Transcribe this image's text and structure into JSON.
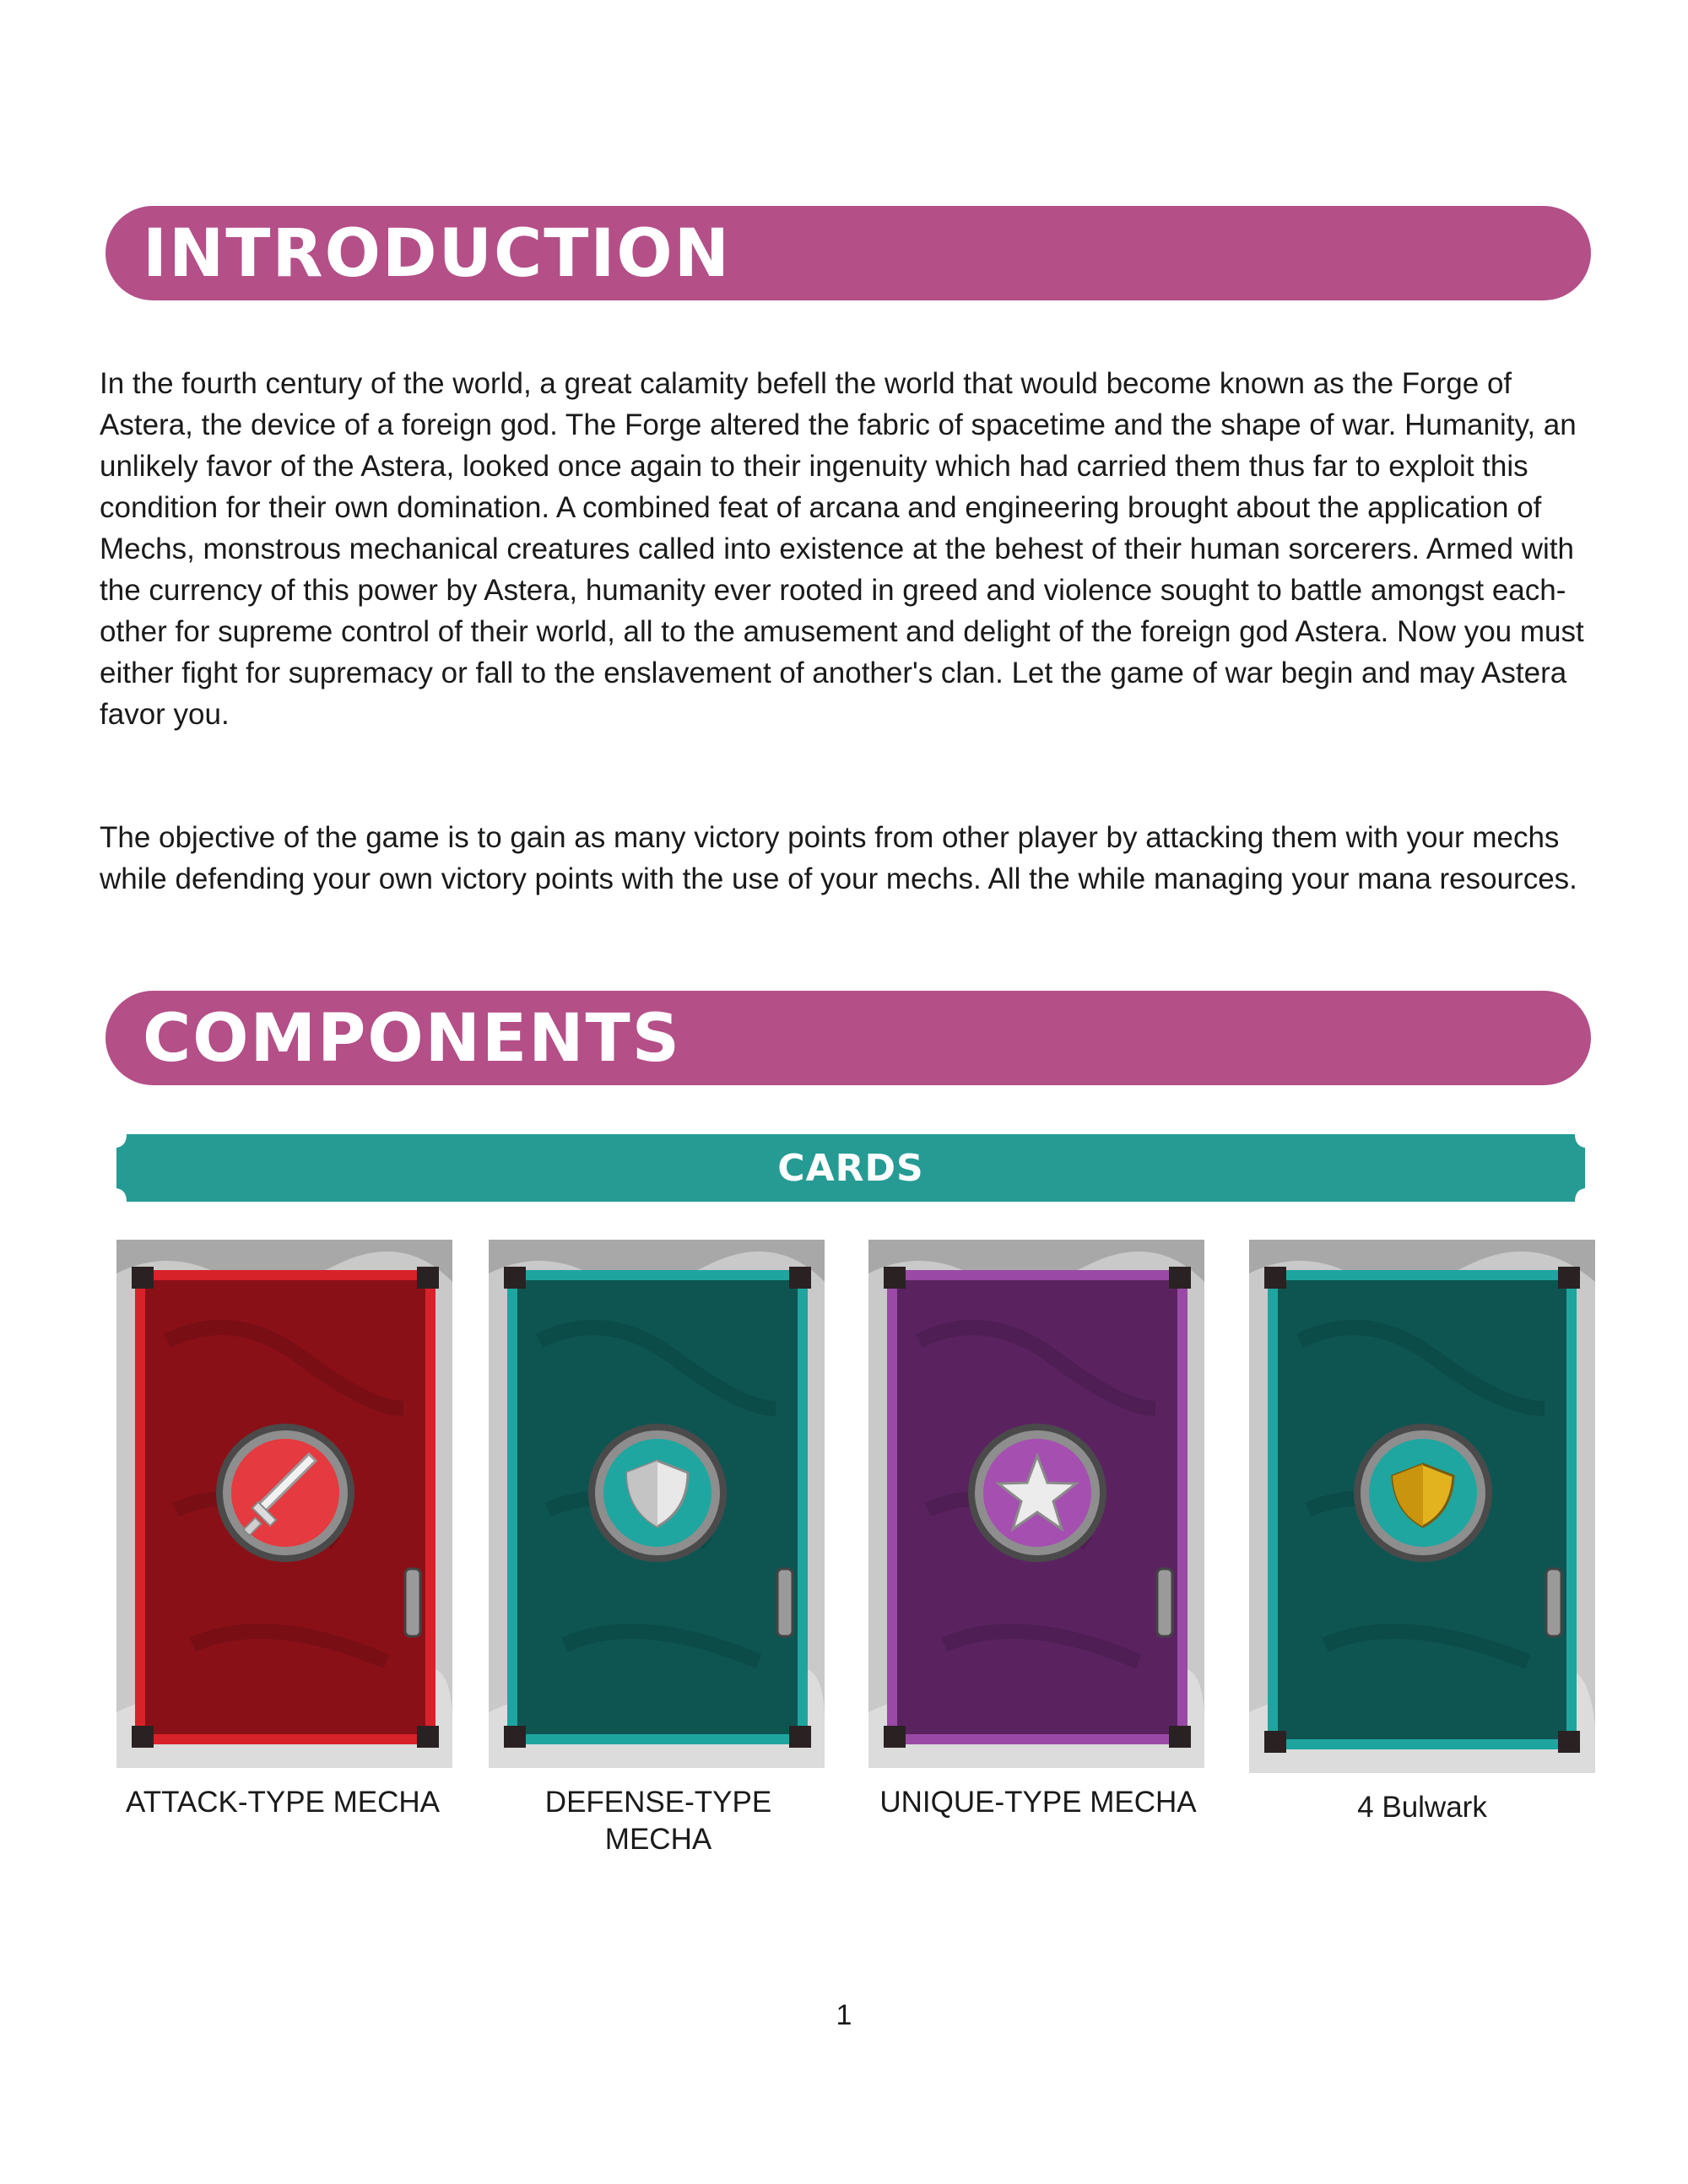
{
  "sections": {
    "introduction": {
      "title": "INTRODUCTION",
      "paragraph_1": "In the fourth century of the world, a great calamity befell the world that would become known as the Forge of Astera, the device of a foreign god. The Forge altered the fabric of spacetime and the shape of war. Humanity, an unlikely favor of the Astera, looked once again to their ingenuity which had carried them thus far to exploit this condition for their own domination. A combined feat of arcana and engineering brought about the application of Mechs, monstrous mechanical creatures called into existence at the behest of their human sorcerers. Armed with the currency of this power by Astera, humanity ever rooted in greed and violence sought to battle amongst each-other for supreme control of their world, all to the amusement and delight of the foreign god Astera. Now you must either fight for supremacy or fall to the enslavement of another's clan. Let the game of war begin and may Astera favor you.",
      "paragraph_2": "The objective of the game is to gain as many victory points from other player by attacking them with your mechs while defending your own victory points with the use of your mechs. All the while managing your mana resources."
    },
    "components": {
      "title": "COMPONENTS",
      "cards_heading": "CARDS",
      "cards": [
        {
          "caption": "ATTACK-TYPE MECHA",
          "icon": "sword-icon",
          "body_color": "#8a1018",
          "frame_color": "#d8222a",
          "emblem_color": "#e53a3f"
        },
        {
          "caption": "DEFENSE-TYPE MECHA",
          "icon": "shield-icon",
          "body_color": "#0e5552",
          "frame_color": "#1fa59f",
          "emblem_color": "#1fa6a0"
        },
        {
          "caption": "UNIQUE-TYPE MECHA",
          "icon": "star-icon",
          "body_color": "#5a2360",
          "frame_color": "#9a4aa6",
          "emblem_color": "#a54fb0"
        },
        {
          "caption": "4 Bulwark",
          "icon": "gold-shield-icon",
          "body_color": "#0e5552",
          "frame_color": "#1fa59f",
          "emblem_color": "#1fa6a0"
        }
      ]
    }
  },
  "footer": {
    "page_number": "1"
  },
  "colors": {
    "section_banner": "#b44f88",
    "cards_banner": "#259b94"
  }
}
